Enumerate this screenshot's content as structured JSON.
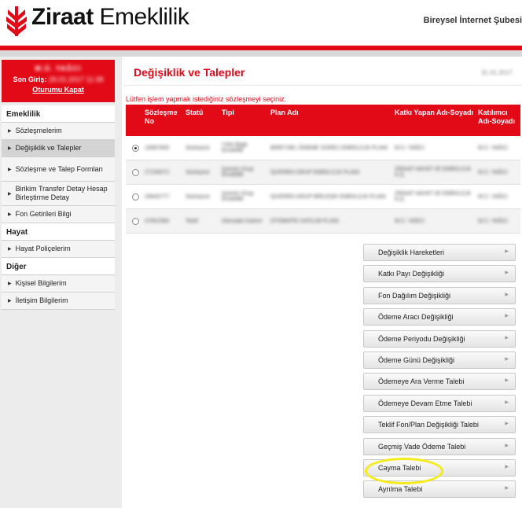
{
  "header": {
    "brand_bold": "Ziraat",
    "brand_rest": " Emeklilik",
    "portal": "Bireysel İnternet Şubesi",
    "logo_icon": "ziraat-wheat-logo-icon",
    "accent_color": "#e30a17"
  },
  "user": {
    "name": "M.Ü. YAĞCI",
    "last_login_label": "Son Giriş:",
    "last_login_value": "26.01.2017 11:38",
    "logout_label": "Oturumu Kapat"
  },
  "sidebar": {
    "sections": [
      {
        "title": "Emeklilik",
        "items": [
          {
            "label": "Sözleşmelerim",
            "active": false
          },
          {
            "label": "Değişiklik ve Talepler",
            "active": true
          },
          {
            "label": "Sözleşme ve Talep Formları",
            "active": false
          },
          {
            "label": "Birikim Transfer Detay Hesap Birleştirme Detay",
            "active": false
          },
          {
            "label": "Fon Getirileri Bilgi",
            "active": false
          }
        ]
      },
      {
        "title": "Hayat",
        "items": [
          {
            "label": "Hayat Poliçelerim",
            "active": false
          }
        ]
      },
      {
        "title": "Diğer",
        "items": [
          {
            "label": "Kişisel Bilgilerim",
            "active": false
          },
          {
            "label": "İletişim Bilgilerim",
            "active": false
          }
        ]
      }
    ]
  },
  "main": {
    "title": "Değişiklik ve Talepler",
    "date": "31.01.2017",
    "notice": "Lütfen işlem yapmak istediğiniz sözleşmeyi seçiniz.",
    "table": {
      "headers": [
        "Sözleşme No",
        "Statü",
        "Tipi",
        "Plan Adı",
        "Katkı Yapan Adı-Soyadı",
        "Katılımcı Adı-Soyadı"
      ],
      "rows": [
        {
          "selected": true,
          "cells": [
            "16997609",
            "Sözleşme",
            "Yıllık Bağlı Emeklilik",
            "BİREYSEL ÖDEME SÜRELİ EMEKLİLİK PLANI",
            "M.Ü. YAĞCI",
            "M.Ü. YAĞCI"
          ]
        },
        {
          "selected": false,
          "cells": [
            "27230072",
            "Sözleşme",
            "İşveren Grup Emeklilik",
            "İŞVEREN GRUP EMEKLİLİK PLANI",
            "ZİRAAT HAYAT VE EMEKLİLİK A.Ş.",
            "M.Ü. YAĞCI"
          ]
        },
        {
          "selected": false,
          "cells": [
            "29640777",
            "Sözleşme",
            "İşveren Grup Emeklilik",
            "İŞVEREN GRUP BİRLEŞİK EMEKLİLİK PLANI",
            "ZİRAAT HAYAT VE EMEKLİLİK A.Ş.",
            "M.Ü. YAĞCI"
          ]
        },
        {
          "selected": false,
          "cells": [
            "47602384",
            "Teklif",
            "Otomatik Katılım",
            "OTOMATİK KATILIM PLANI",
            "M.Ü. YAĞCI",
            "M.Ü. YAĞCI"
          ]
        }
      ]
    },
    "actions": [
      "Değişiklik Hareketleri",
      "Katkı Payı Değişikliği",
      "Fon Dağılım Değişikliği",
      "Ödeme Aracı Değişikliği",
      "Ödeme Periyodu Değişikliği",
      "Ödeme Günü Değişikliği",
      "Ödemeye Ara Verme Talebi",
      "Ödemeye Devam Etme Talebi",
      "Teklif Fon/Plan Değişikliği Talebi",
      "Geçmiş Vade Ödeme Talebi",
      "Cayma Talebi",
      "Ayrılma Talebi"
    ],
    "highlighted_action": "Cayma Talebi",
    "highlight_color": "#f5ea1a"
  }
}
